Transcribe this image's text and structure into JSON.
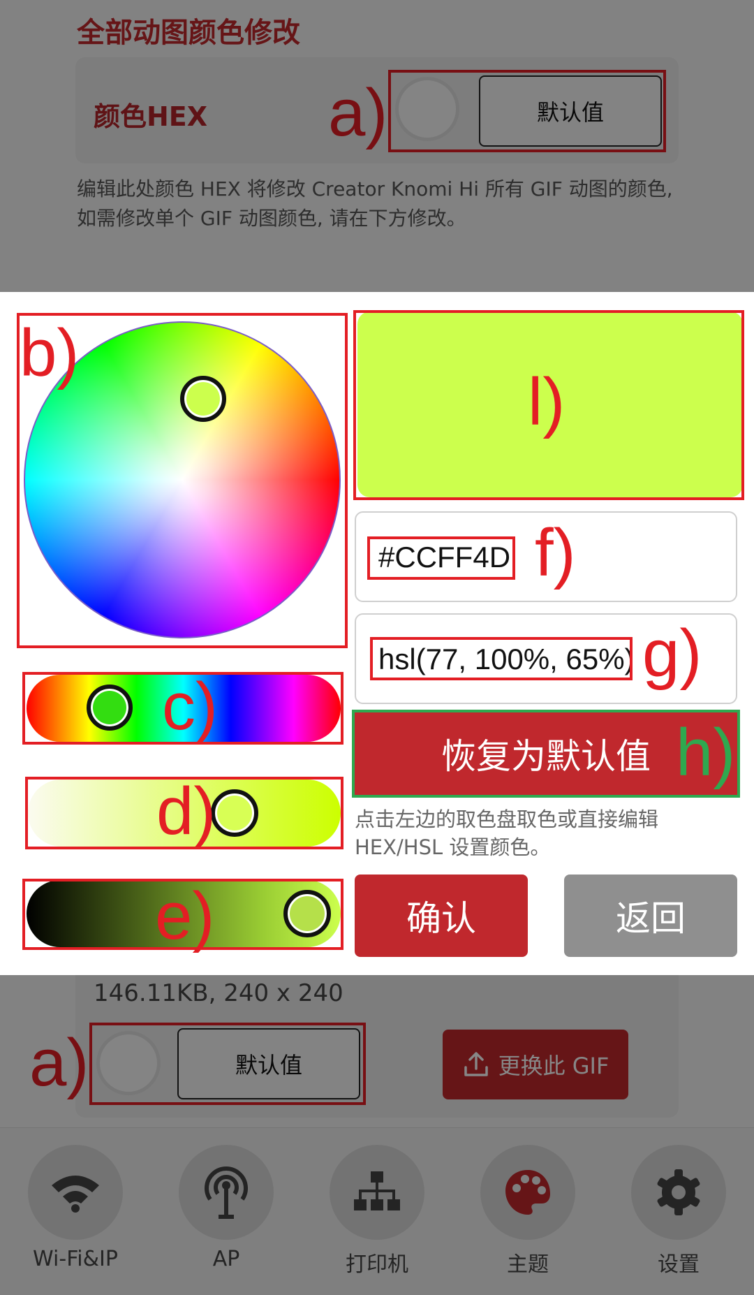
{
  "colors": {
    "brand_red": "#c0282d",
    "selected_color": "#ccff4d",
    "annotation_red": "#e31e24",
    "annotation_green": "#2fa84f"
  },
  "background_page": {
    "section_title": "全部动图颜色修改",
    "hex_card": {
      "label": "颜色HEX",
      "default_button": "默认值"
    },
    "description": "编辑此处颜色 HEX 将修改 Creator Knomi Hi 所有 GIF 动图的颜色, 如需修改单个 GIF 动图颜色, 请在下方修改。",
    "gif_card": {
      "file_info": "146.11KB, 240 x 240",
      "default_button": "默认值",
      "replace_button": "更换此 GIF",
      "replace_icon": "upload-icon"
    }
  },
  "bottom_nav": [
    {
      "label": "Wi-Fi&IP",
      "icon": "wifi-icon"
    },
    {
      "label": "AP",
      "icon": "antenna-icon"
    },
    {
      "label": "打印机",
      "icon": "network-tree-icon"
    },
    {
      "label": "主题",
      "icon": "palette-icon",
      "active": true
    },
    {
      "label": "设置",
      "icon": "gear-icon"
    }
  ],
  "color_picker": {
    "hex_value": "#CCFF4D",
    "hsl_value": "hsl(77, 100%, 65%)",
    "hue": 77,
    "saturation_percent": 100,
    "lightness_percent": 65,
    "reset_button": "恢复为默认值",
    "hint": "点击左边的取色盘取色或直接编辑 HEX/HSL 设置颜色。",
    "confirm_button": "确认",
    "back_button": "返回"
  },
  "annotations": {
    "a": "a)",
    "b": "b)",
    "c": "c)",
    "d": "d)",
    "e": "e)",
    "f": "f)",
    "g": "g)",
    "h": "h)",
    "l": "l)"
  }
}
